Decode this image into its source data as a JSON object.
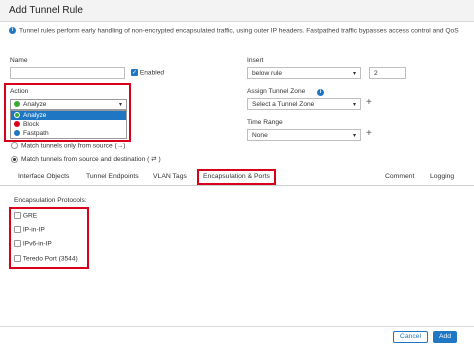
{
  "dialog": {
    "title": "Add Tunnel Rule"
  },
  "info_text": "Tunnel rules perform early handling of non-encrypted encapsulated traffic, using outer IP headers. Fastpathed traffic bypasses access control and QoS",
  "name": {
    "label": "Name",
    "value": ""
  },
  "enabled": {
    "label": "Enabled",
    "checked": true
  },
  "insert": {
    "label": "Insert",
    "value": "below rule",
    "number": "2"
  },
  "action": {
    "label": "Action",
    "selected": "Analyze",
    "options": [
      {
        "label": "Analyze",
        "color": "#3aaa35"
      },
      {
        "label": "Block",
        "color": "#d9001b"
      },
      {
        "label": "Fastpath",
        "color": "#1f77c4"
      }
    ]
  },
  "tunnel_zone": {
    "label": "Assign Tunnel Zone",
    "value": "Select a Tunnel Zone"
  },
  "time_range": {
    "label": "Time Range",
    "value": "None"
  },
  "match": {
    "option1": "Match tunnels only from source",
    "option2": "Match tunnels from source and destination",
    "arrow1": "(→)",
    "arrow2": "( ⇄ )"
  },
  "tabs": {
    "interface_objects": "Interface Objects",
    "tunnel_endpoints": "Tunnel Endpoints",
    "vlan_tags": "VLAN Tags",
    "encapsulation": "Encapsulation & Ports",
    "comment": "Comment",
    "logging": "Logging"
  },
  "encapsulation": {
    "label": "Encapsulation Protocols:",
    "protocols": [
      "GRE",
      "IP-in-IP",
      "IPv6-in-IP",
      "Teredo Port (3544)"
    ]
  },
  "buttons": {
    "cancel": "Cancel",
    "add": "Add"
  },
  "colors": {
    "accent": "#1f77c4",
    "highlight": "#d9001b",
    "analyze": "#3aaa35"
  }
}
